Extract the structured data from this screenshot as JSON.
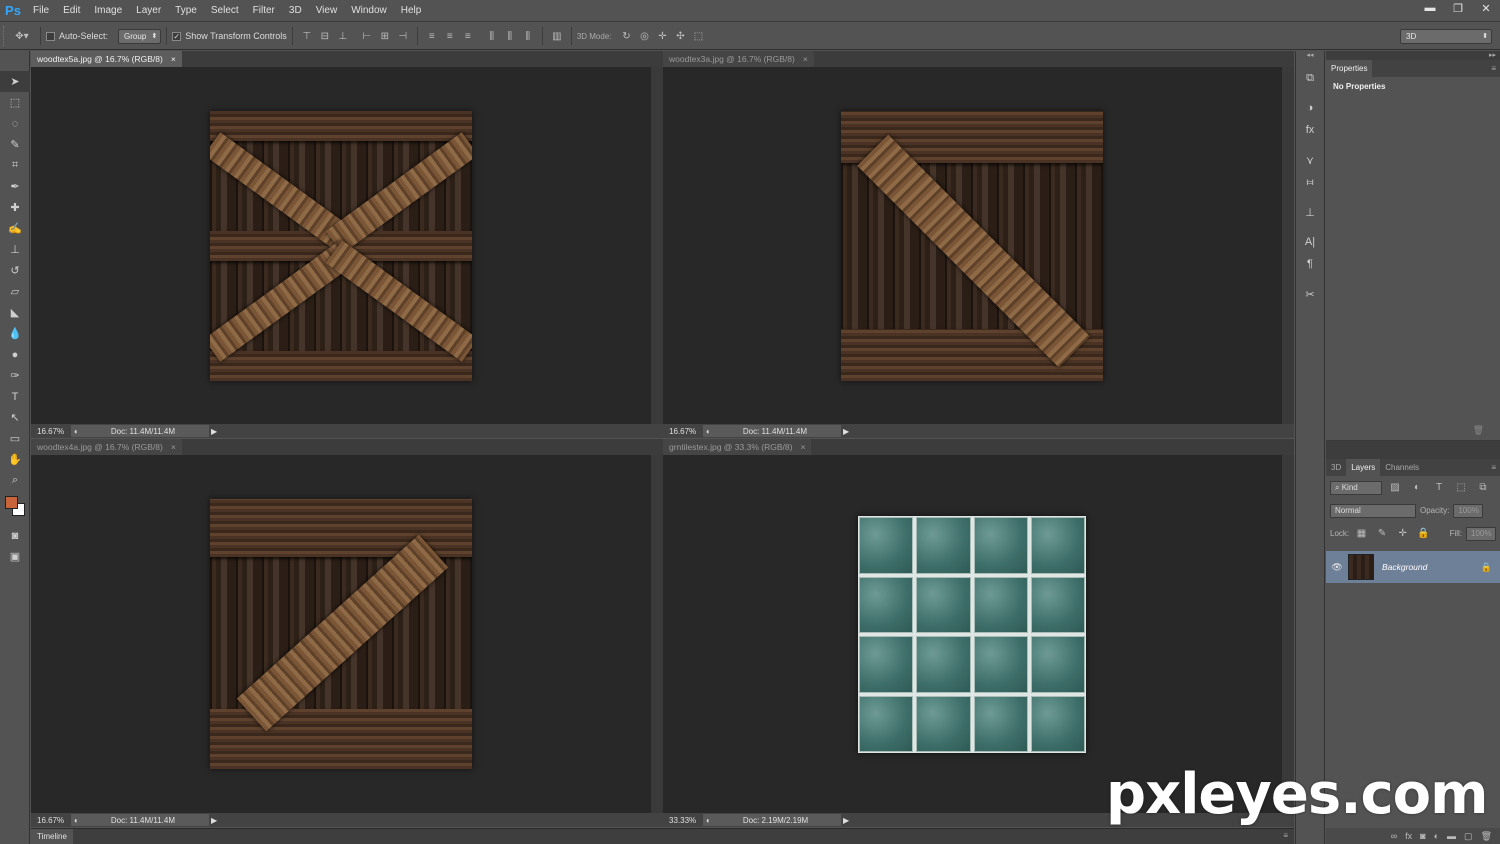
{
  "app": {
    "logo": "Ps"
  },
  "menu": [
    "File",
    "Edit",
    "Image",
    "Layer",
    "Type",
    "Select",
    "Filter",
    "3D",
    "View",
    "Window",
    "Help"
  ],
  "window_controls": {
    "minimize": "▬",
    "restore": "❐",
    "close": "✕"
  },
  "options": {
    "auto_select_label": "Auto-Select:",
    "auto_select_value": "Group",
    "show_transform_label": "Show Transform Controls",
    "mode_3d_label": "3D Mode:",
    "workspace_value": "3D"
  },
  "documents": [
    {
      "tab": "woodtex5a.jpg @ 16.7% (RGB/8)",
      "zoom": "16.67%",
      "doc": "Doc: 11.4M/11.4M",
      "active": true
    },
    {
      "tab": "woodtex3a.jpg @ 16.7% (RGB/8)",
      "zoom": "16.67%",
      "doc": "Doc: 11.4M/11.4M",
      "active": false
    },
    {
      "tab": "woodtex4a.jpg @ 16.7% (RGB/8)",
      "zoom": "16.67%",
      "doc": "Doc: 11.4M/11.4M",
      "active": false
    },
    {
      "tab": "grntilestex.jpg @ 33.3% (RGB/8)",
      "zoom": "33.33%",
      "doc": "Doc: 2.19M/2.19M",
      "active": false
    }
  ],
  "tab_close": "×",
  "properties": {
    "tab": "Properties",
    "content": "No Properties"
  },
  "layers_panel": {
    "tabs": [
      "3D",
      "Layers",
      "Channels"
    ],
    "kind_label": "Kind",
    "blend_mode": "Normal",
    "opacity_label": "Opacity:",
    "opacity_value": "100%",
    "lock_label": "Lock:",
    "fill_label": "Fill:",
    "fill_value": "100%",
    "layer_name": "Background"
  },
  "timeline": "Timeline",
  "watermark": "pxleyes.com",
  "colors": {
    "foreground": "#c8643a",
    "background": "#ffffff",
    "accent": "#31a8ff",
    "layer_selected": "#6e7f98"
  }
}
